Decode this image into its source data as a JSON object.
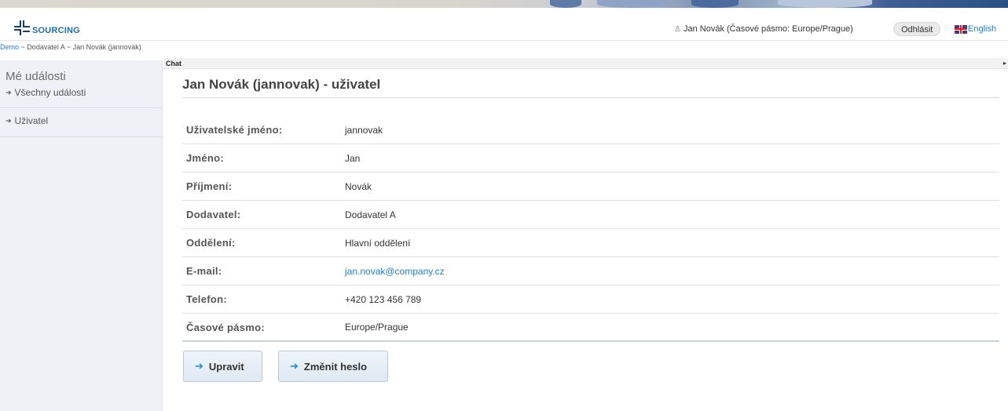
{
  "header": {
    "logo_text": "SOURCING",
    "user_label": "Jan Novák (Časové pásmo: Europe/Prague)",
    "logout_label": "Odhlásit",
    "language_label": "English"
  },
  "breadcrumb": {
    "items": [
      "Demo",
      "~",
      "Dodavatel A",
      "~",
      "Jan Novák (jannovak)"
    ]
  },
  "sidebar": {
    "section_title": "Mé události",
    "items": [
      {
        "label": "Všechny události"
      },
      {
        "label": "Uživatel"
      }
    ]
  },
  "chat": {
    "label": "Chat"
  },
  "main": {
    "title": "Jan Novák (jannovak) - uživatel",
    "fields": [
      {
        "label": "Uživatelské jméno:",
        "value": "jannovak"
      },
      {
        "label": "Jméno:",
        "value": "Jan"
      },
      {
        "label": "Příjmení:",
        "value": "Novák"
      },
      {
        "label": "Dodavatel:",
        "value": "Dodavatel A"
      },
      {
        "label": "Oddělení:",
        "value": "Hlavní oddělení"
      },
      {
        "label": "E-mail:",
        "value": "jan.novak@company.cz"
      },
      {
        "label": "Telefon:",
        "value": "+420 123 456 789"
      },
      {
        "label": "Časové pásmo:",
        "value": "Europe/Prague"
      }
    ],
    "buttons": {
      "edit_label": "Upravit",
      "change_password_label": "Změnit heslo"
    }
  },
  "icons": {
    "user": "user-icon",
    "flag": "uk-flag-icon",
    "nav_arrow": "arrow-right-icon",
    "button_arrow": "blue-arrow-right-icon",
    "chat_toggle": "chevron-right-icon"
  },
  "colors": {
    "link": "#1e7fd0",
    "brand": "#153f6b",
    "sidebar_bg": "#eef1f5"
  }
}
